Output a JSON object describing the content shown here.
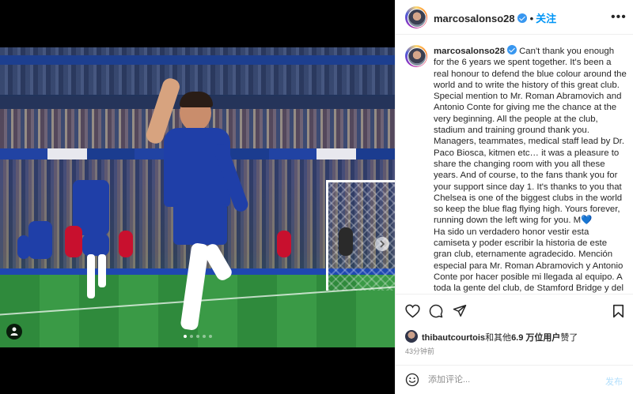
{
  "post": {
    "author": "marcosalonso28",
    "follow_label": "关注",
    "dot": "•",
    "more": "•••",
    "caption_en": "Can't thank you enough for the 6 years we spent together. It's been a real honour to defend the blue colour around the world and to write the history of this great club. Special mention to Mr. Roman Abramovich and Antonio Conte for giving me the chance at the very beginning. All the people at the club, stadium and training ground thank you. Managers, teammates, medical staff lead by Dr. Paco Biosca, kitmen etc… it was a pleasure to share the changing room with you all these years. And of course, to the fans thank you for your support since day 1. It's thanks to you that Chelsea is one of the biggest clubs in the world so keep the blue flag flying high. Yours forever, running down the left wing for you. M",
    "caption_heart": "💙",
    "caption_es": "Ha sido un verdadero honor vestir esta camiseta y poder escribir la historia de este gran club, eternamente agradecido. Mención especial para Mr. Roman Abramovich y Antonio Conte por hacer posible mi llegada al equipo. A toda la gente del club, de Stamford Bridge y del dia a día"
  },
  "likes": {
    "user": "thibautcourtois",
    "rest": "和其他",
    "count": "6.9 万位用户",
    "suffix": "赞了"
  },
  "time_ago": "43分钟前",
  "comment": {
    "placeholder": "添加评论...",
    "post_label": "发布"
  },
  "carousel": {
    "total": 5,
    "active": 0
  },
  "colors": {
    "accent": "#0095f6",
    "verified": "#3897f0",
    "post_disabled": "#b2dffc"
  },
  "icons": [
    "heart-icon",
    "comment-icon",
    "share-icon",
    "bookmark-icon",
    "emoji-icon",
    "user-tag-icon",
    "next-arrow-icon",
    "more-icon",
    "verified-icon"
  ]
}
